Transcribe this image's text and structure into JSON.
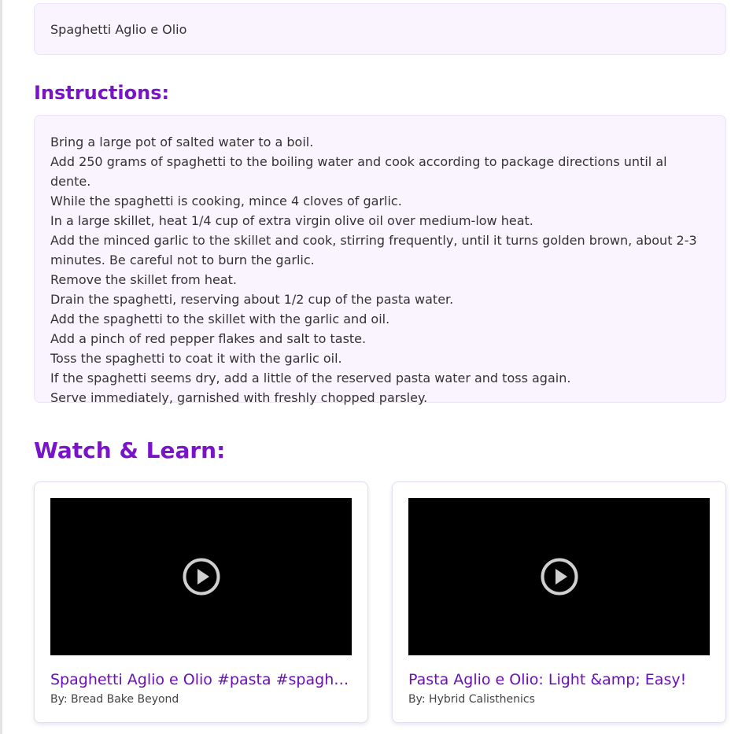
{
  "recipe": {
    "name": "Spaghetti Aglio e Olio"
  },
  "instructions": {
    "heading": "Instructions:",
    "steps": [
      "Bring a large pot of salted water to a boil.",
      "Add 250 grams of spaghetti to the boiling water and cook according to package directions until al dente.",
      "While the spaghetti is cooking, mince 4 cloves of garlic.",
      "In a large skillet, heat 1/4 cup of extra virgin olive oil over medium-low heat.",
      "Add the minced garlic to the skillet and cook, stirring frequently, until it turns golden brown, about 2-3 minutes. Be careful not to burn the garlic.",
      "Remove the skillet from heat.",
      "Drain the spaghetti, reserving about 1/2 cup of the pasta water.",
      "Add the spaghetti to the skillet with the garlic and oil.",
      "Add a pinch of red pepper flakes and salt to taste.",
      "Toss the spaghetti to coat it with the garlic oil.",
      "If the spaghetti seems dry, add a little of the reserved pasta water and toss again.",
      "Serve immediately, garnished with freshly chopped parsley."
    ]
  },
  "videos": {
    "heading": "Watch & Learn:",
    "items": [
      {
        "title": "Spaghetti Aglio e Olio #pasta #spaghetti",
        "channel": "By: Bread Bake Beyond"
      },
      {
        "title": "Pasta Aglio e Olio: Light &amp; Easy!",
        "channel": "By: Hybrid Calisthenics"
      }
    ]
  },
  "colors": {
    "accent": "#7a14c9",
    "panel_background": "#f9f4ff"
  }
}
